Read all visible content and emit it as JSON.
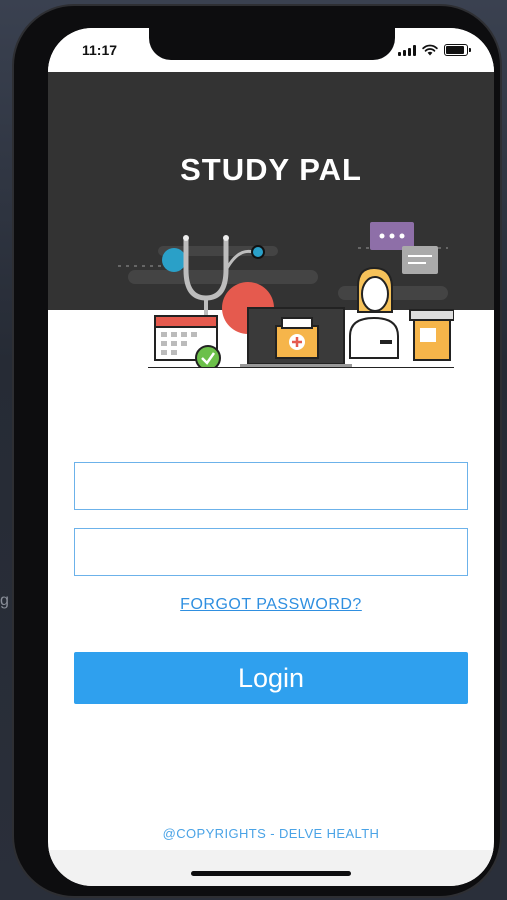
{
  "status_bar": {
    "time": "11:17",
    "battery_level": 0.9
  },
  "app": {
    "title": "STUDY PAL"
  },
  "login_form": {
    "username": {
      "value": "",
      "placeholder": ""
    },
    "password": {
      "value": "",
      "placeholder": ""
    },
    "forgot_password_label": "FORGOT PASSWORD?",
    "login_label": "Login"
  },
  "footer": {
    "copyright": "@COPYRIGHTS - DELVE HEALTH"
  },
  "colors": {
    "header_bg": "#333333",
    "accent": "#2fa0ee",
    "link": "#2f8fe0",
    "input_border": "#6cb2ea"
  },
  "icons": [
    "wifi-icon",
    "battery-icon",
    "cellular-signal-icon",
    "medical-illustration"
  ]
}
